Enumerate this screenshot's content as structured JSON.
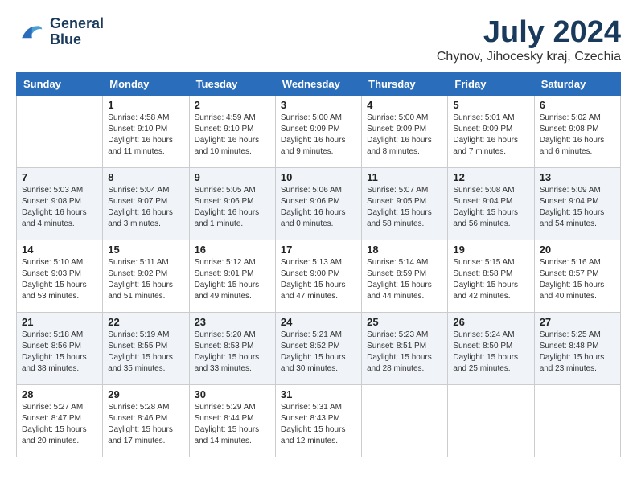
{
  "header": {
    "logo_line1": "General",
    "logo_line2": "Blue",
    "month_year": "July 2024",
    "location": "Chynov, Jihocesky kraj, Czechia"
  },
  "days_of_week": [
    "Sunday",
    "Monday",
    "Tuesday",
    "Wednesday",
    "Thursday",
    "Friday",
    "Saturday"
  ],
  "weeks": [
    [
      {
        "day": "",
        "info": ""
      },
      {
        "day": "1",
        "info": "Sunrise: 4:58 AM\nSunset: 9:10 PM\nDaylight: 16 hours\nand 11 minutes."
      },
      {
        "day": "2",
        "info": "Sunrise: 4:59 AM\nSunset: 9:10 PM\nDaylight: 16 hours\nand 10 minutes."
      },
      {
        "day": "3",
        "info": "Sunrise: 5:00 AM\nSunset: 9:09 PM\nDaylight: 16 hours\nand 9 minutes."
      },
      {
        "day": "4",
        "info": "Sunrise: 5:00 AM\nSunset: 9:09 PM\nDaylight: 16 hours\nand 8 minutes."
      },
      {
        "day": "5",
        "info": "Sunrise: 5:01 AM\nSunset: 9:09 PM\nDaylight: 16 hours\nand 7 minutes."
      },
      {
        "day": "6",
        "info": "Sunrise: 5:02 AM\nSunset: 9:08 PM\nDaylight: 16 hours\nand 6 minutes."
      }
    ],
    [
      {
        "day": "7",
        "info": "Sunrise: 5:03 AM\nSunset: 9:08 PM\nDaylight: 16 hours\nand 4 minutes."
      },
      {
        "day": "8",
        "info": "Sunrise: 5:04 AM\nSunset: 9:07 PM\nDaylight: 16 hours\nand 3 minutes."
      },
      {
        "day": "9",
        "info": "Sunrise: 5:05 AM\nSunset: 9:06 PM\nDaylight: 16 hours\nand 1 minute."
      },
      {
        "day": "10",
        "info": "Sunrise: 5:06 AM\nSunset: 9:06 PM\nDaylight: 16 hours\nand 0 minutes."
      },
      {
        "day": "11",
        "info": "Sunrise: 5:07 AM\nSunset: 9:05 PM\nDaylight: 15 hours\nand 58 minutes."
      },
      {
        "day": "12",
        "info": "Sunrise: 5:08 AM\nSunset: 9:04 PM\nDaylight: 15 hours\nand 56 minutes."
      },
      {
        "day": "13",
        "info": "Sunrise: 5:09 AM\nSunset: 9:04 PM\nDaylight: 15 hours\nand 54 minutes."
      }
    ],
    [
      {
        "day": "14",
        "info": "Sunrise: 5:10 AM\nSunset: 9:03 PM\nDaylight: 15 hours\nand 53 minutes."
      },
      {
        "day": "15",
        "info": "Sunrise: 5:11 AM\nSunset: 9:02 PM\nDaylight: 15 hours\nand 51 minutes."
      },
      {
        "day": "16",
        "info": "Sunrise: 5:12 AM\nSunset: 9:01 PM\nDaylight: 15 hours\nand 49 minutes."
      },
      {
        "day": "17",
        "info": "Sunrise: 5:13 AM\nSunset: 9:00 PM\nDaylight: 15 hours\nand 47 minutes."
      },
      {
        "day": "18",
        "info": "Sunrise: 5:14 AM\nSunset: 8:59 PM\nDaylight: 15 hours\nand 44 minutes."
      },
      {
        "day": "19",
        "info": "Sunrise: 5:15 AM\nSunset: 8:58 PM\nDaylight: 15 hours\nand 42 minutes."
      },
      {
        "day": "20",
        "info": "Sunrise: 5:16 AM\nSunset: 8:57 PM\nDaylight: 15 hours\nand 40 minutes."
      }
    ],
    [
      {
        "day": "21",
        "info": "Sunrise: 5:18 AM\nSunset: 8:56 PM\nDaylight: 15 hours\nand 38 minutes."
      },
      {
        "day": "22",
        "info": "Sunrise: 5:19 AM\nSunset: 8:55 PM\nDaylight: 15 hours\nand 35 minutes."
      },
      {
        "day": "23",
        "info": "Sunrise: 5:20 AM\nSunset: 8:53 PM\nDaylight: 15 hours\nand 33 minutes."
      },
      {
        "day": "24",
        "info": "Sunrise: 5:21 AM\nSunset: 8:52 PM\nDaylight: 15 hours\nand 30 minutes."
      },
      {
        "day": "25",
        "info": "Sunrise: 5:23 AM\nSunset: 8:51 PM\nDaylight: 15 hours\nand 28 minutes."
      },
      {
        "day": "26",
        "info": "Sunrise: 5:24 AM\nSunset: 8:50 PM\nDaylight: 15 hours\nand 25 minutes."
      },
      {
        "day": "27",
        "info": "Sunrise: 5:25 AM\nSunset: 8:48 PM\nDaylight: 15 hours\nand 23 minutes."
      }
    ],
    [
      {
        "day": "28",
        "info": "Sunrise: 5:27 AM\nSunset: 8:47 PM\nDaylight: 15 hours\nand 20 minutes."
      },
      {
        "day": "29",
        "info": "Sunrise: 5:28 AM\nSunset: 8:46 PM\nDaylight: 15 hours\nand 17 minutes."
      },
      {
        "day": "30",
        "info": "Sunrise: 5:29 AM\nSunset: 8:44 PM\nDaylight: 15 hours\nand 14 minutes."
      },
      {
        "day": "31",
        "info": "Sunrise: 5:31 AM\nSunset: 8:43 PM\nDaylight: 15 hours\nand 12 minutes."
      },
      {
        "day": "",
        "info": ""
      },
      {
        "day": "",
        "info": ""
      },
      {
        "day": "",
        "info": ""
      }
    ]
  ]
}
